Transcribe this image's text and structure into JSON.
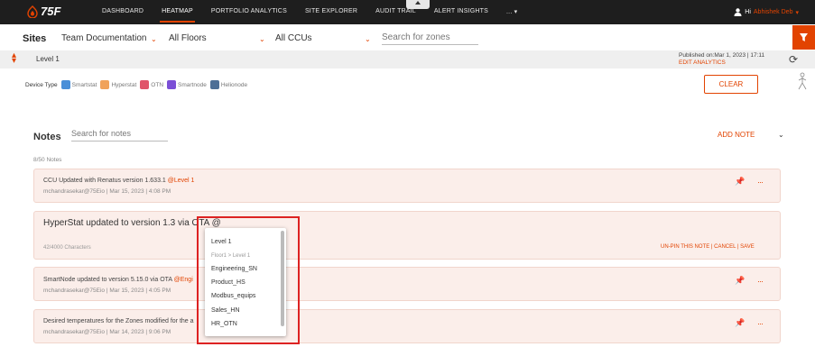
{
  "brand": {
    "logo_text": "75F",
    "accent": "#e24301"
  },
  "nav": {
    "items": [
      "DASHBOARD",
      "HEATMAP",
      "PORTFOLIO ANALYTICS",
      "SITE EXPLORER",
      "AUDIT TRAIL",
      "ALERT INSIGHTS",
      "..."
    ],
    "active": "HEATMAP"
  },
  "user": {
    "greeting": "Hi",
    "name": "Abhishek Deb"
  },
  "sites_bar": {
    "label": "Sites",
    "site_value": "Team Documentation",
    "floors_value": "All Floors",
    "ccus_value": "All CCUs",
    "zones_placeholder": "Search for zones"
  },
  "level_bar": {
    "level_name": "Level 1",
    "published": "Published on:Mar 1, 2023 | 17:11",
    "edit_analytics": "EDIT ANALYTICS"
  },
  "device_type": {
    "label": "Device Type",
    "items": [
      {
        "name": "Smartstat",
        "color": "#4a8fd8"
      },
      {
        "name": "Hyperstat",
        "color": "#f0a25a"
      },
      {
        "name": "OTN",
        "color": "#e0556a"
      },
      {
        "name": "Smartnode",
        "color": "#7b4fd6"
      },
      {
        "name": "Helionode",
        "color": "#4d6f96"
      }
    ],
    "clear_label": "CLEAR"
  },
  "notes": {
    "title": "Notes",
    "search_placeholder": "Search for notes",
    "add_label": "ADD NOTE",
    "count": "8/50 Notes",
    "items": [
      {
        "text": "CCU Updated with Renatus version 1.633.1",
        "mention": "@Level 1",
        "meta": "mchandrasekar@75Eio | Mar 15, 2023 | 4:08 PM"
      },
      {
        "text": "SmartNode updated to version 5.15.0 via OTA",
        "mention": "@Engi",
        "meta": "mchandrasekar@75Eio | Mar 15, 2023 | 4:05 PM"
      },
      {
        "text": "Desired temperatures for the Zones modified for the a",
        "mention": "",
        "meta": "mchandrasekar@75Eio | Mar 14, 2023 | 9:06 PM"
      }
    ],
    "editing": {
      "text": "HyperStat updated to version 1.3 via OTA @",
      "chars": "42/4000 Characters",
      "unpin": "UN-PIN THIS NOTE",
      "cancel": "CANCEL",
      "save": "SAVE",
      "separator": "|"
    }
  },
  "mention_dropdown": {
    "items": [
      {
        "label": "Level 1",
        "kind": "item"
      },
      {
        "label": "Floor1 > Level 1",
        "kind": "sub"
      },
      {
        "label": "Engineering_SN",
        "kind": "item"
      },
      {
        "label": "Product_HS",
        "kind": "item"
      },
      {
        "label": "Modbus_equips",
        "kind": "item"
      },
      {
        "label": "Sales_HN",
        "kind": "item"
      },
      {
        "label": "HR_OTN",
        "kind": "item"
      }
    ]
  }
}
